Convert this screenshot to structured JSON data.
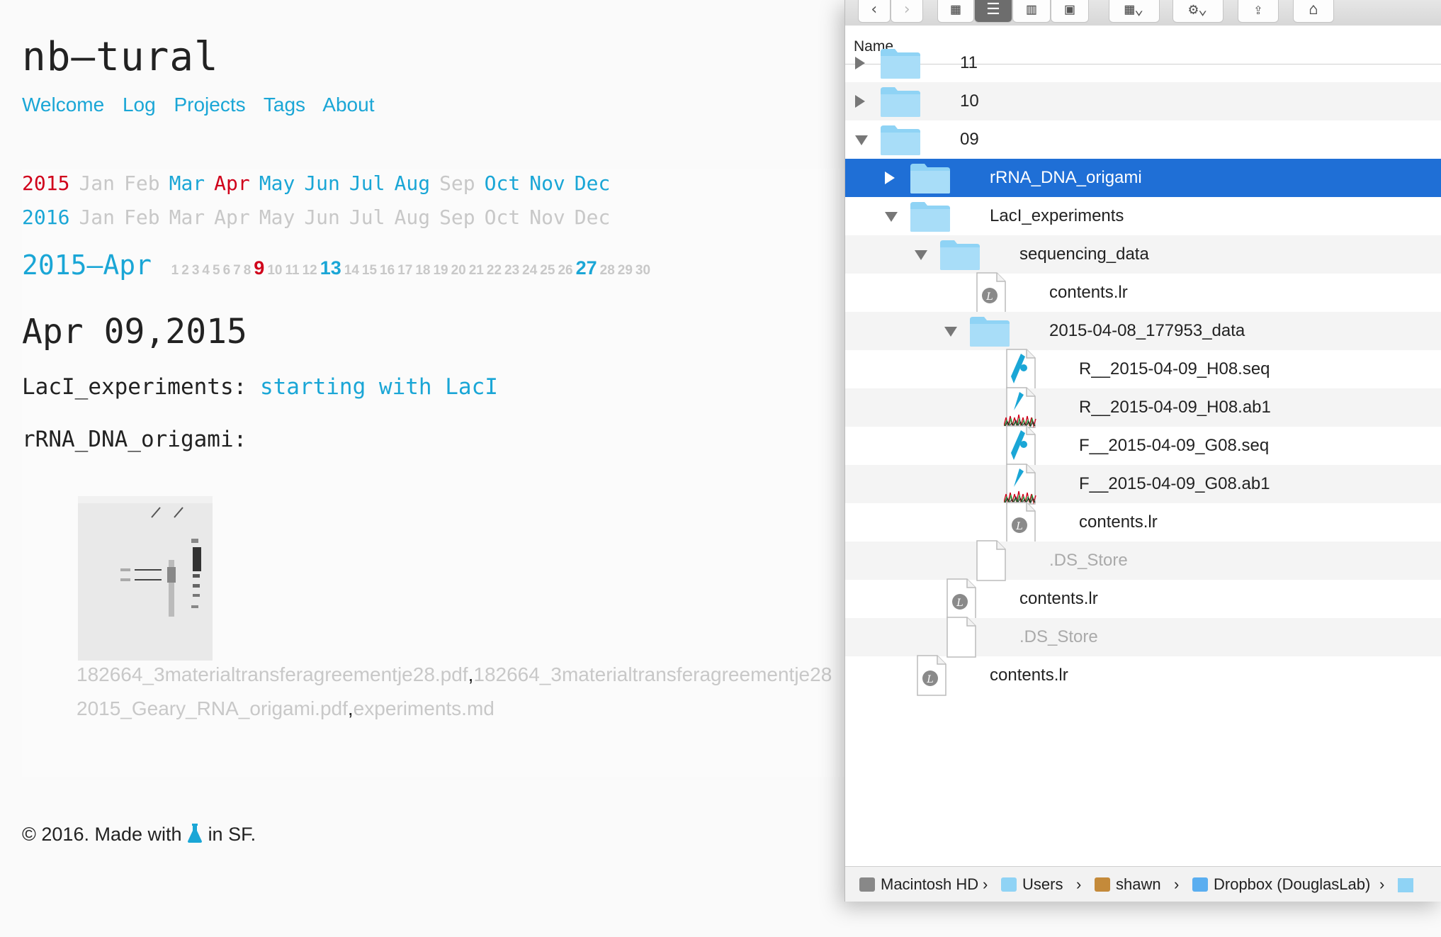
{
  "blog": {
    "title": "nb–tural",
    "nav": [
      "Welcome",
      "Log",
      "Projects",
      "Tags",
      "About"
    ],
    "years": [
      {
        "year": "2015",
        "months": [
          {
            "m": "Jan",
            "state": "off"
          },
          {
            "m": "Feb",
            "state": "off"
          },
          {
            "m": "Mar",
            "state": "on"
          },
          {
            "m": "Apr",
            "state": "red"
          },
          {
            "m": "May",
            "state": "on"
          },
          {
            "m": "Jun",
            "state": "on"
          },
          {
            "m": "Jul",
            "state": "on"
          },
          {
            "m": "Aug",
            "state": "on"
          },
          {
            "m": "Sep",
            "state": "off"
          },
          {
            "m": "Oct",
            "state": "on"
          },
          {
            "m": "Nov",
            "state": "on"
          },
          {
            "m": "Dec",
            "state": "on"
          }
        ]
      },
      {
        "year": "2016",
        "months": [
          {
            "m": "Jan",
            "state": "off"
          },
          {
            "m": "Feb",
            "state": "off"
          },
          {
            "m": "Mar",
            "state": "off"
          },
          {
            "m": "Apr",
            "state": "off"
          },
          {
            "m": "May",
            "state": "off"
          },
          {
            "m": "Jun",
            "state": "off"
          },
          {
            "m": "Jul",
            "state": "off"
          },
          {
            "m": "Aug",
            "state": "off"
          },
          {
            "m": "Sep",
            "state": "off"
          },
          {
            "m": "Oct",
            "state": "off"
          },
          {
            "m": "Nov",
            "state": "off"
          },
          {
            "m": "Dec",
            "state": "off"
          }
        ]
      }
    ],
    "month_heading": "2015–Apr",
    "days": [
      {
        "d": "1",
        "s": "off"
      },
      {
        "d": "2",
        "s": "off"
      },
      {
        "d": "3",
        "s": "off"
      },
      {
        "d": "4",
        "s": "off"
      },
      {
        "d": "5",
        "s": "off"
      },
      {
        "d": "6",
        "s": "off"
      },
      {
        "d": "7",
        "s": "off"
      },
      {
        "d": "8",
        "s": "off"
      },
      {
        "d": "9",
        "s": "red"
      },
      {
        "d": "10",
        "s": "off"
      },
      {
        "d": "11",
        "s": "off"
      },
      {
        "d": "12",
        "s": "off"
      },
      {
        "d": "13",
        "s": "on"
      },
      {
        "d": "14",
        "s": "off"
      },
      {
        "d": "15",
        "s": "off"
      },
      {
        "d": "16",
        "s": "off"
      },
      {
        "d": "17",
        "s": "off"
      },
      {
        "d": "18",
        "s": "off"
      },
      {
        "d": "19",
        "s": "off"
      },
      {
        "d": "20",
        "s": "off"
      },
      {
        "d": "21",
        "s": "off"
      },
      {
        "d": "22",
        "s": "off"
      },
      {
        "d": "23",
        "s": "off"
      },
      {
        "d": "24",
        "s": "off"
      },
      {
        "d": "25",
        "s": "off"
      },
      {
        "d": "26",
        "s": "off"
      },
      {
        "d": "27",
        "s": "on"
      },
      {
        "d": "28",
        "s": "off"
      },
      {
        "d": "29",
        "s": "off"
      },
      {
        "d": "30",
        "s": "off"
      }
    ],
    "post_date": "Apr 09,2015",
    "entry1_project": "LacI_experiments:",
    "entry1_link": "starting with LacI",
    "entry2_project": "rRNA_DNA_origami:",
    "files_line1": [
      "182664_3materialtransferagreementje28.pdf",
      ",",
      "182664_3materialtransferagreementje28"
    ],
    "files_line2": [
      "2015_Geary_RNA_origami.pdf",
      ",",
      "experiments.md"
    ],
    "footer_before": "© 2016. Made with",
    "footer_after": "in SF."
  },
  "finder": {
    "column_name": "Name",
    "rows": [
      {
        "name": "11",
        "indent": 0,
        "tri": "right",
        "icon": "folder",
        "alt": false,
        "partial": true
      },
      {
        "name": "10",
        "indent": 0,
        "tri": "right",
        "icon": "folder",
        "alt": true
      },
      {
        "name": "09",
        "indent": 0,
        "tri": "down",
        "icon": "folder",
        "alt": false
      },
      {
        "name": "rRNA_DNA_origami",
        "indent": 1,
        "tri": "right",
        "icon": "folder",
        "selected": true
      },
      {
        "name": "LacI_experiments",
        "indent": 1,
        "tri": "down",
        "icon": "folder",
        "alt": false
      },
      {
        "name": "sequencing_data",
        "indent": 2,
        "tri": "down",
        "icon": "folder",
        "alt": true
      },
      {
        "name": "contents.lr",
        "indent": 3,
        "tri": "none",
        "icon": "lr",
        "alt": false
      },
      {
        "name": "2015-04-08_177953_data",
        "indent": 3,
        "tri": "down",
        "icon": "folder",
        "alt": true
      },
      {
        "name": "R__2015-04-09_H08.seq",
        "indent": 4,
        "tri": "none",
        "icon": "seq",
        "alt": false
      },
      {
        "name": "R__2015-04-09_H08.ab1",
        "indent": 4,
        "tri": "none",
        "icon": "ab1",
        "alt": true
      },
      {
        "name": "F__2015-04-09_G08.seq",
        "indent": 4,
        "tri": "none",
        "icon": "seq",
        "alt": false
      },
      {
        "name": "F__2015-04-09_G08.ab1",
        "indent": 4,
        "tri": "none",
        "icon": "ab1",
        "alt": true
      },
      {
        "name": "contents.lr",
        "indent": 4,
        "tri": "none",
        "icon": "lr",
        "alt": false
      },
      {
        "name": ".DS_Store",
        "indent": 3,
        "tri": "none",
        "icon": "blank",
        "alt": true,
        "dim": true
      },
      {
        "name": "contents.lr",
        "indent": 2,
        "tri": "none",
        "icon": "lr",
        "alt": false
      },
      {
        "name": ".DS_Store",
        "indent": 2,
        "tri": "none",
        "icon": "blank",
        "alt": true,
        "dim": true
      },
      {
        "name": "contents.lr",
        "indent": 1,
        "tri": "none",
        "icon": "lr",
        "alt": false,
        "partial": true
      }
    ],
    "path": [
      "Macintosh HD",
      "Users",
      "shawn",
      "Dropbox (DouglasLab)"
    ],
    "path_icons": [
      "disk-icon",
      "users-folder-icon",
      "home-icon",
      "dropbox-folder-icon"
    ]
  },
  "colors": {
    "link": "#1aa6d6",
    "highlight": "#d0021b",
    "selection": "#1f6fd6",
    "folder": "#8fd3f5"
  }
}
